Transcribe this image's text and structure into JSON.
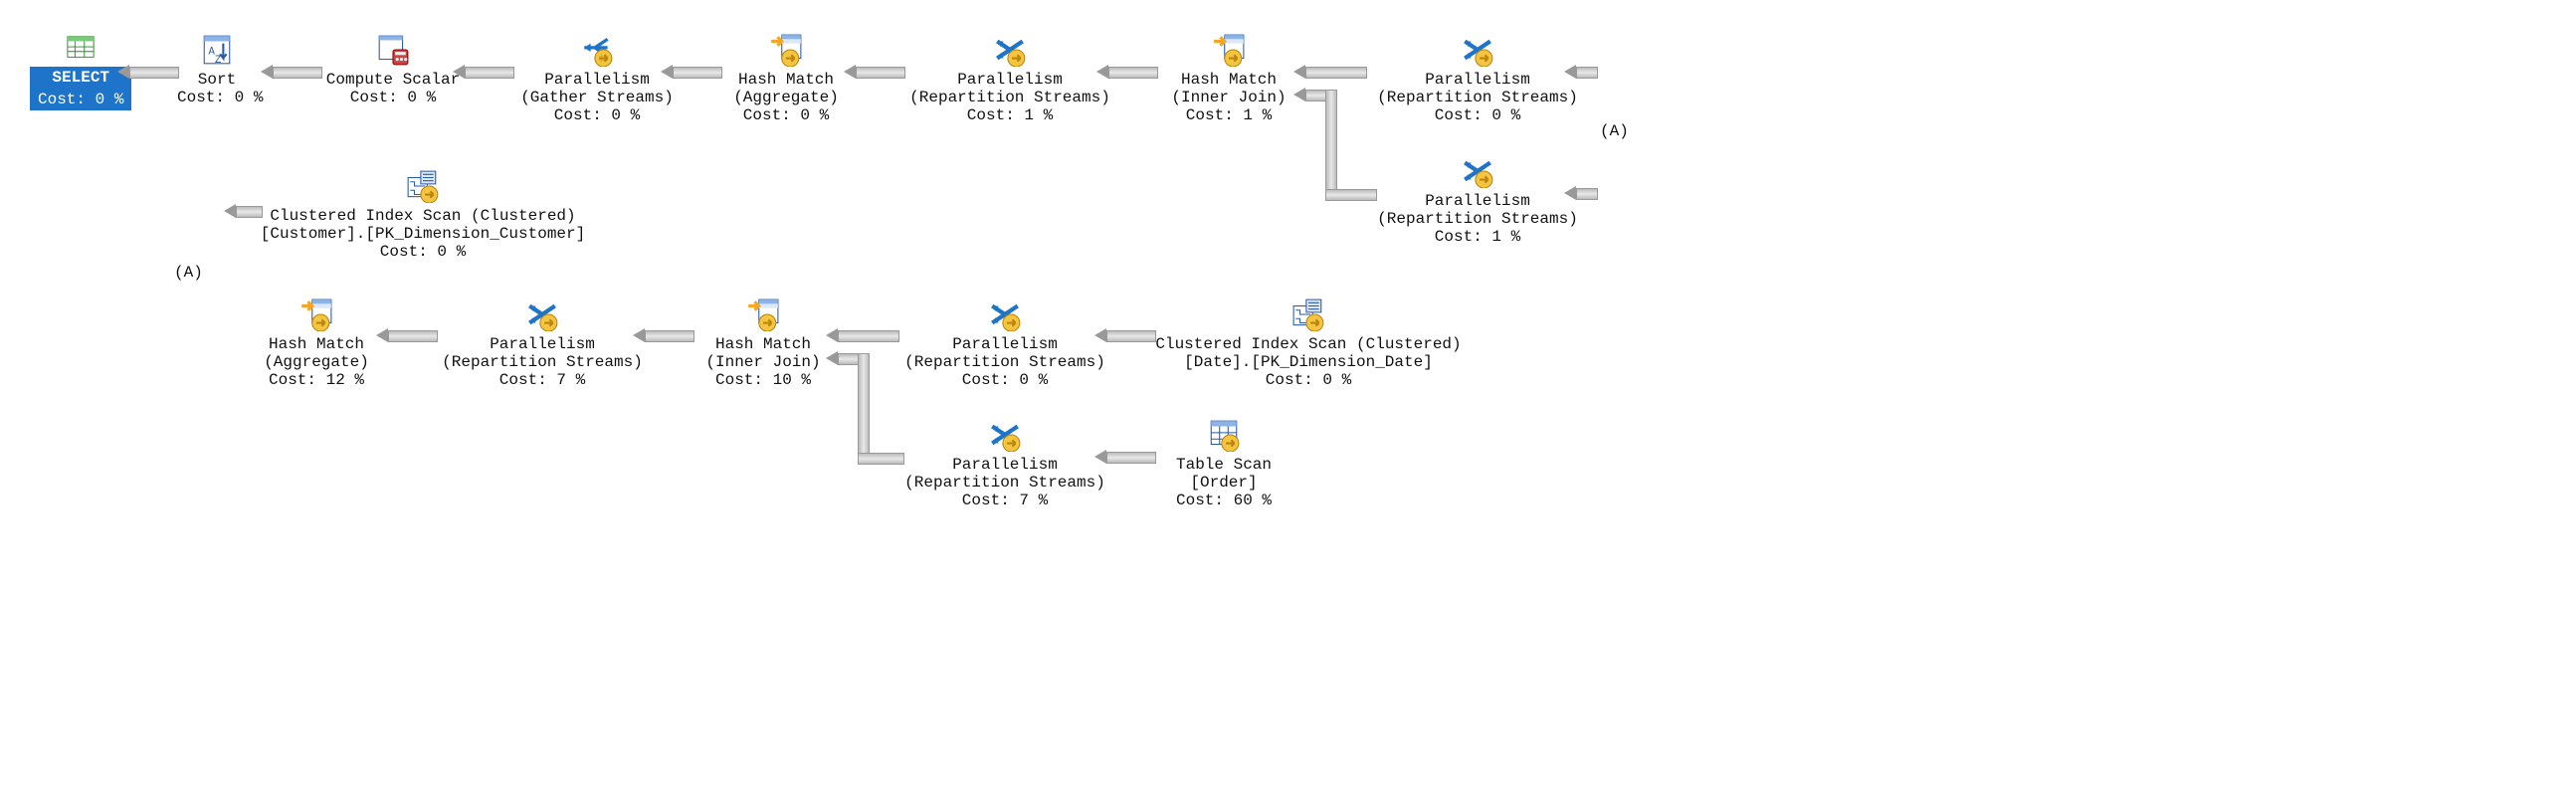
{
  "annotations": {
    "a1": "(A)",
    "a2": "(A)"
  },
  "nodes": {
    "select": {
      "label": "SELECT",
      "cost": "Cost: 0 %"
    },
    "sort": {
      "label": "Sort",
      "cost": "Cost: 0 %"
    },
    "compute_scalar": {
      "label": "Compute Scalar",
      "cost": "Cost: 0 %"
    },
    "par_gather": {
      "label": "Parallelism",
      "sub": "(Gather Streams)",
      "cost": "Cost: 0 %"
    },
    "hash_agg_top": {
      "label": "Hash Match",
      "sub": "(Aggregate)",
      "cost": "Cost: 0 %"
    },
    "par_repart_1": {
      "label": "Parallelism",
      "sub": "(Repartition Streams)",
      "cost": "Cost: 1 %"
    },
    "hash_join_top": {
      "label": "Hash Match",
      "sub": "(Inner Join)",
      "cost": "Cost: 1 %"
    },
    "par_repart_0a": {
      "label": "Parallelism",
      "sub": "(Repartition Streams)",
      "cost": "Cost: 0 %"
    },
    "par_repart_1b": {
      "label": "Parallelism",
      "sub": "(Repartition Streams)",
      "cost": "Cost: 1 %"
    },
    "cis_customer": {
      "label": "Clustered Index Scan (Clustered)",
      "sub": "[Customer].[PK_Dimension_Customer]",
      "cost": "Cost: 0 %"
    },
    "hash_agg_bot": {
      "label": "Hash Match",
      "sub": "(Aggregate)",
      "cost": "Cost: 12 %"
    },
    "par_repart_7a": {
      "label": "Parallelism",
      "sub": "(Repartition Streams)",
      "cost": "Cost: 7 %"
    },
    "hash_join_bot": {
      "label": "Hash Match",
      "sub": "(Inner Join)",
      "cost": "Cost: 10 %"
    },
    "par_repart_0b": {
      "label": "Parallelism",
      "sub": "(Repartition Streams)",
      "cost": "Cost: 0 %"
    },
    "cis_date": {
      "label": "Clustered Index Scan (Clustered)",
      "sub": "[Date].[PK_Dimension_Date]",
      "cost": "Cost: 0 %"
    },
    "par_repart_7b": {
      "label": "Parallelism",
      "sub": "(Repartition Streams)",
      "cost": "Cost: 7 %"
    },
    "table_scan": {
      "label": "Table Scan",
      "sub": "[Order]",
      "cost": "Cost: 60 %"
    }
  }
}
